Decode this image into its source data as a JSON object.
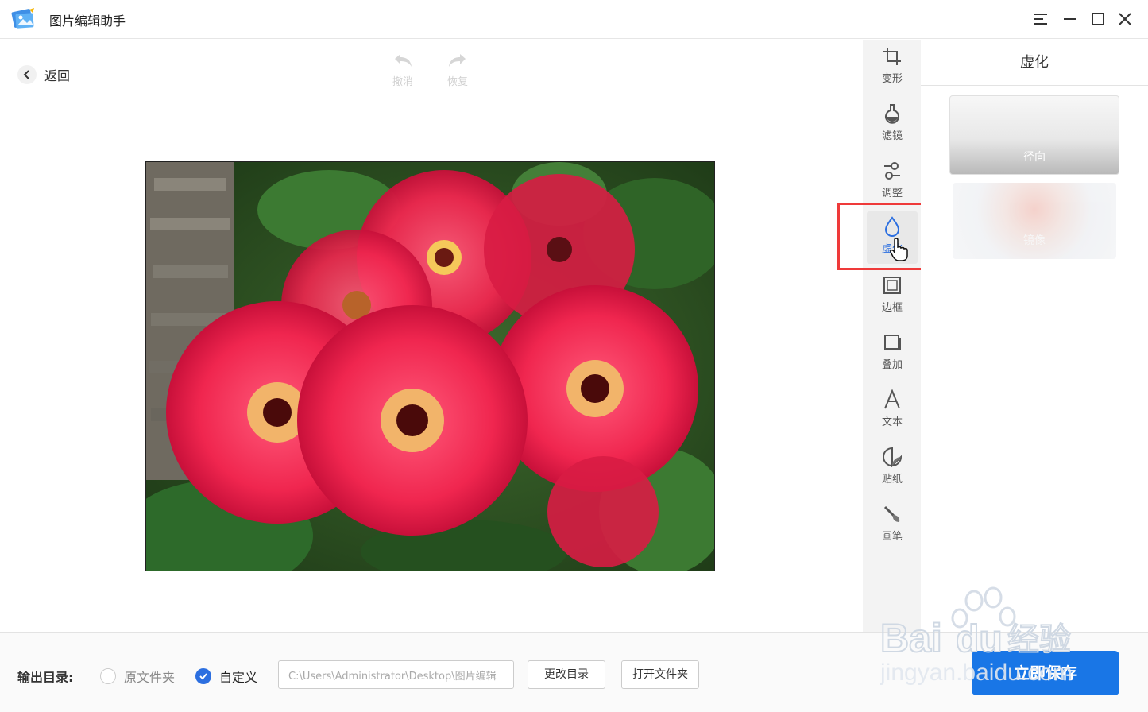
{
  "window": {
    "title": "图片编辑助手",
    "menu_icon": "menu-icon",
    "minimize_icon": "minimize-icon",
    "maximize_icon": "maximize-icon",
    "close_icon": "close-icon"
  },
  "editor": {
    "back_label": "返回",
    "undo_label": "撤消",
    "redo_label": "恢复"
  },
  "toolbar": {
    "items": [
      {
        "label": "变形",
        "icon": "crop-icon"
      },
      {
        "label": "滤镜",
        "icon": "flask-icon"
      },
      {
        "label": "调整",
        "icon": "adjust-icon"
      },
      {
        "label": "虚化",
        "icon": "drop-icon",
        "active": true
      },
      {
        "label": "边框",
        "icon": "frame-icon"
      },
      {
        "label": "叠加",
        "icon": "overlay-icon"
      },
      {
        "label": "文本",
        "icon": "text-icon"
      },
      {
        "label": "贴纸",
        "icon": "sticker-icon"
      },
      {
        "label": "画笔",
        "icon": "brush-icon"
      }
    ]
  },
  "panel": {
    "title": "虚化",
    "effects": [
      {
        "label": "径向"
      },
      {
        "label": "镜像"
      }
    ]
  },
  "bottom": {
    "output_label": "输出目录:",
    "option_original": "原文件夹",
    "option_custom": "自定义",
    "custom_selected": true,
    "path_value": "C:\\Users\\Administrator\\Desktop\\图片编辑",
    "change_dir_label": "更改目录",
    "open_folder_label": "打开文件夹",
    "save_label": "立即保存"
  },
  "watermark": {
    "line1": "Bai",
    "line1b": "经验",
    "line2": "jingyan.baidu.com"
  },
  "colors": {
    "accent": "#1976e6",
    "highlight": "#ef3a3a",
    "active_label": "#2c6fe0"
  }
}
